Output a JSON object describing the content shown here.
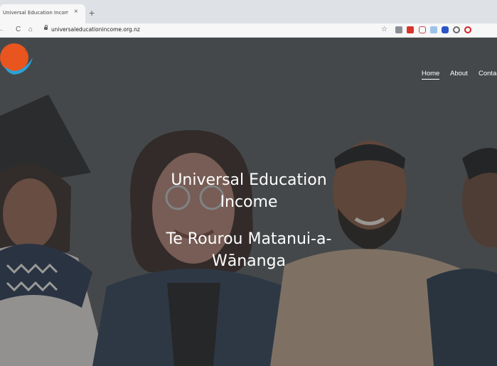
{
  "browser": {
    "tab_title": "Universal Education Income | U",
    "close_glyph": "×",
    "new_tab_glyph": "+",
    "back_glyph": "←",
    "reload_glyph": "C",
    "home_glyph": "⌂",
    "url": "universaleducationincome.org.nz",
    "star_glyph": "☆",
    "extensions": [
      "extension-icon",
      "extension-icon",
      "pocket-icon",
      "extension-icon",
      "extension-icon",
      "extension-icon",
      "opera-icon"
    ]
  },
  "site": {
    "nav": [
      {
        "label": "Home",
        "active": true
      },
      {
        "label": "About",
        "active": false
      },
      {
        "label": "Conta",
        "active": false
      }
    ],
    "heading_en": "Universal Education Income",
    "heading_mi": "Te Rourou Matanui-a-Wānanga"
  },
  "colors": {
    "overlay": "#4f5153",
    "logo_orange": "#e8551f",
    "logo_blue": "#2aa1d8"
  }
}
